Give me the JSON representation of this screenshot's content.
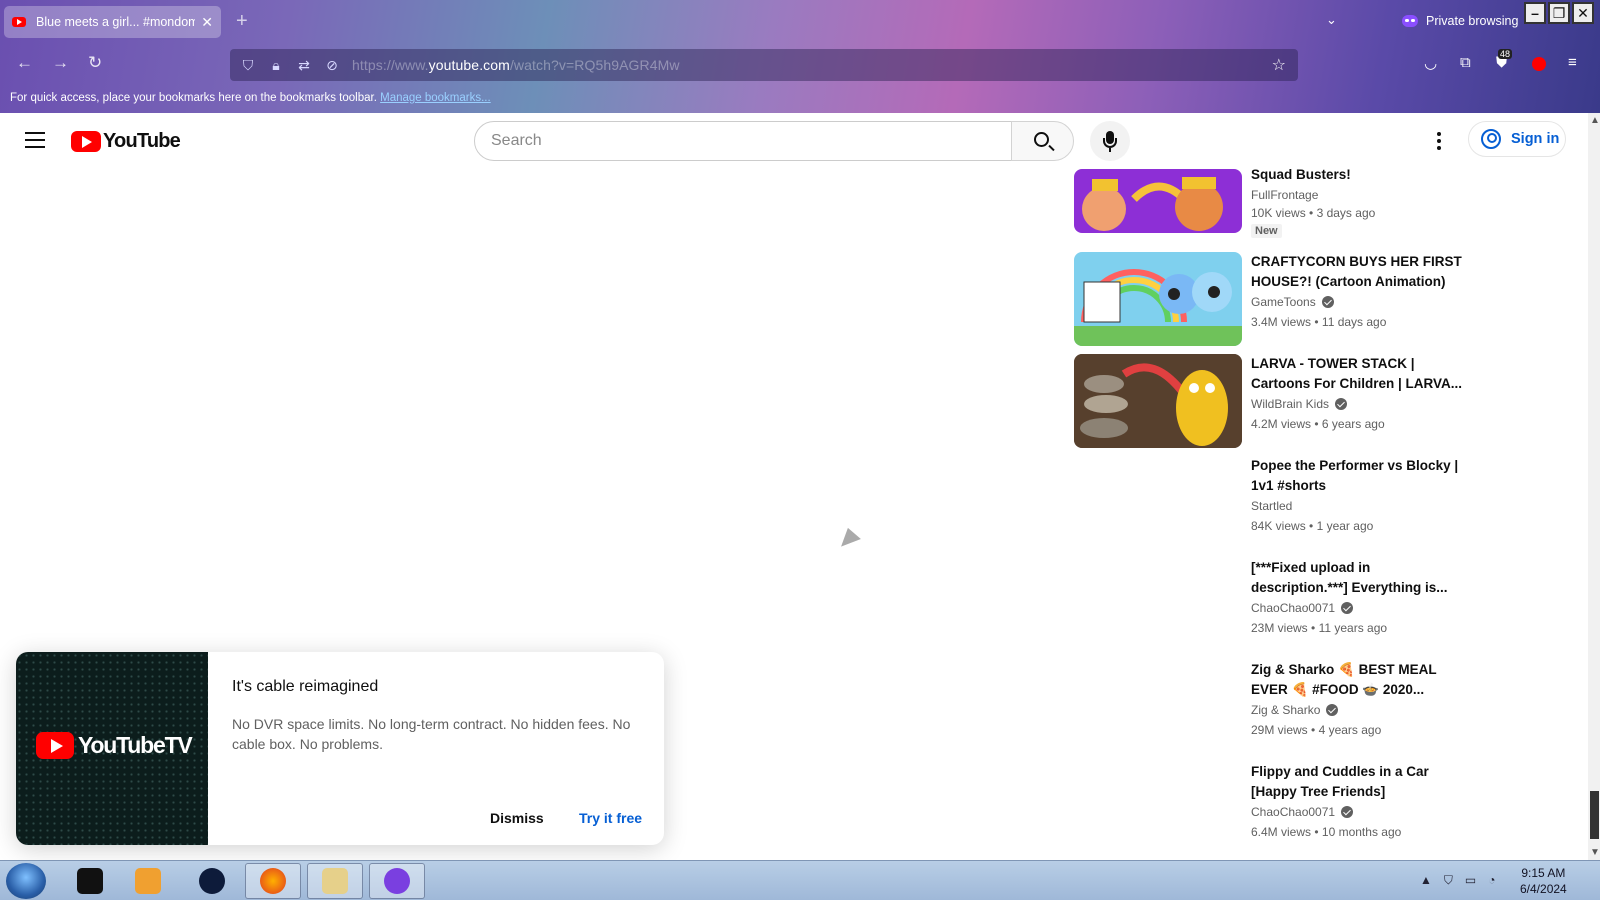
{
  "browser": {
    "tab_title": "Blue meets a girl... #mondome...",
    "new_tab": "+",
    "private_label": "Private browsing",
    "url_dim_prefix": "https://www.",
    "url_domain": "youtube.com",
    "url_path": "/watch?v=RQ5h9AGR4Mw",
    "bookmarks_text": "For quick access, place your bookmarks here on the bookmarks toolbar.",
    "bookmarks_link": "Manage bookmarks...",
    "extension_badge": "48"
  },
  "youtube": {
    "logo_text": "YouTube",
    "search_placeholder": "Search",
    "sign_in": "Sign in"
  },
  "recommendations": [
    {
      "title": "Squad Busters!",
      "channel": "FullFrontage",
      "verified": false,
      "views": "10K views",
      "age": "3 days ago",
      "badge": "New"
    },
    {
      "title": "CRAFTYCORN BUYS HER FIRST HOUSE?! (Cartoon Animation)",
      "channel": "GameToons",
      "verified": true,
      "views": "3.4M views",
      "age": "11 days ago"
    },
    {
      "title": "LARVA - TOWER STACK | Cartoons For Children | LARVA...",
      "channel": "WildBrain Kids",
      "verified": true,
      "views": "4.2M views",
      "age": "6 years ago"
    },
    {
      "title": "Popee the Performer vs Blocky | 1v1 #shorts",
      "channel": "Startled",
      "verified": false,
      "views": "84K views",
      "age": "1 year ago"
    },
    {
      "title": "[***Fixed upload in description.***] Everything is...",
      "channel": "ChaoChao0071",
      "verified": true,
      "views": "23M views",
      "age": "11 years ago"
    },
    {
      "title": "Zig & Sharko 🍕 BEST MEAL EVER 🍕 #FOOD 🍲 2020...",
      "channel": "Zig & Sharko",
      "verified": true,
      "views": "29M views",
      "age": "4 years ago"
    },
    {
      "title": "Flippy and Cuddles in a Car [Happy Tree Friends]",
      "channel": "ChaoChao0071",
      "verified": true,
      "views": "6.4M views",
      "age": "10 months ago"
    }
  ],
  "promo": {
    "logo_text": "YouTubeTV",
    "title": "It's cable reimagined",
    "body": "No DVR space limits. No long-term contract. No hidden fees. No cable box. No problems.",
    "dismiss": "Dismiss",
    "try": "Try it free"
  },
  "taskbar": {
    "time": "9:15 AM",
    "date": "6/4/2024"
  },
  "colors": {
    "youtube_red": "#ff0000",
    "link_blue": "#065fd4",
    "private_purple": "#8a4fff"
  }
}
